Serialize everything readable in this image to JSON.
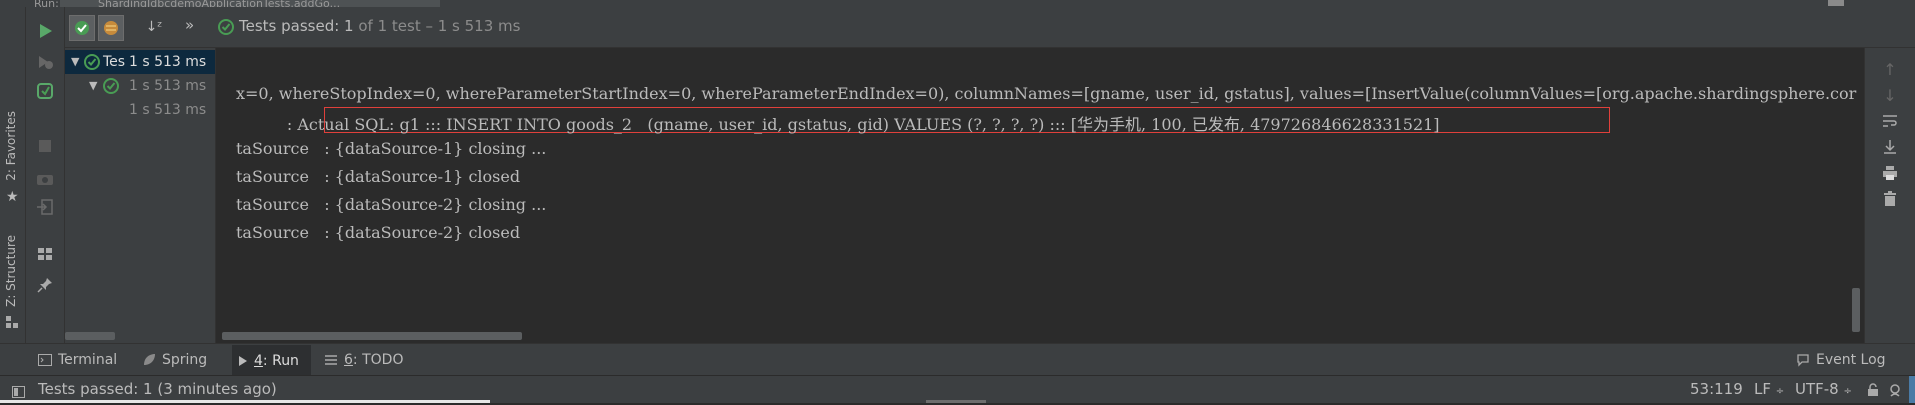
{
  "header": {
    "run_tab_label": "Run:",
    "file_tab_label": "ShardingJdbcdemoApplicationTests.addGo..."
  },
  "left_strip": {
    "favorites_label": "2: Favorites",
    "structure_label": "Z: Structure"
  },
  "test_toolbar": {
    "sort_icon": "sort-alpha-icon",
    "expand_label": "»",
    "status_prefix": "Tests passed: ",
    "status_count": "1",
    "status_suffix": " of 1 test – 1 s 513 ms"
  },
  "tree": {
    "items": [
      {
        "label": "Tes",
        "time": "1 s 513 ms"
      },
      {
        "label": "",
        "time": "1 s 513 ms"
      },
      {
        "label": "",
        "time": "1 s 513 ms"
      }
    ]
  },
  "console": {
    "lines": [
      "x=0, whereStopIndex=0, whereParameterStartIndex=0, whereParameterEndIndex=0), columnNames=[gname, user_id, gstatus], values=[InsertValue(columnValues=[org.apache.shardingsphere.cor",
      "          : Actual SQL: g1 ::: INSERT INTO goods_2   (gname, user_id, gstatus, gid) VALUES (?, ?, ?, ?) ::: [华为手机, 100, 已发布, 479726846628331521]",
      "taSource   : {dataSource-1} closing ...",
      "taSource   : {dataSource-1} closed",
      "taSource   : {dataSource-2} closing ...",
      "taSource   : {dataSource-2} closed"
    ],
    "highlight_color": "#e0403b"
  },
  "bottom_tabs": {
    "terminal": "Terminal",
    "spring": "Spring",
    "run_num": "4",
    "run_label": ": Run",
    "todo_num": "6",
    "todo_label": ": TODO",
    "event_log": "Event Log"
  },
  "status_bar": {
    "message": "Tests passed: 1 (3 minutes ago)",
    "position": "53:119",
    "line_sep": "LF",
    "encoding": "UTF-8"
  },
  "colors": {
    "pass_green": "#499c54",
    "run_green": "#59a869",
    "panel_bg": "#3c3f41",
    "console_bg": "#2b2b2b"
  }
}
